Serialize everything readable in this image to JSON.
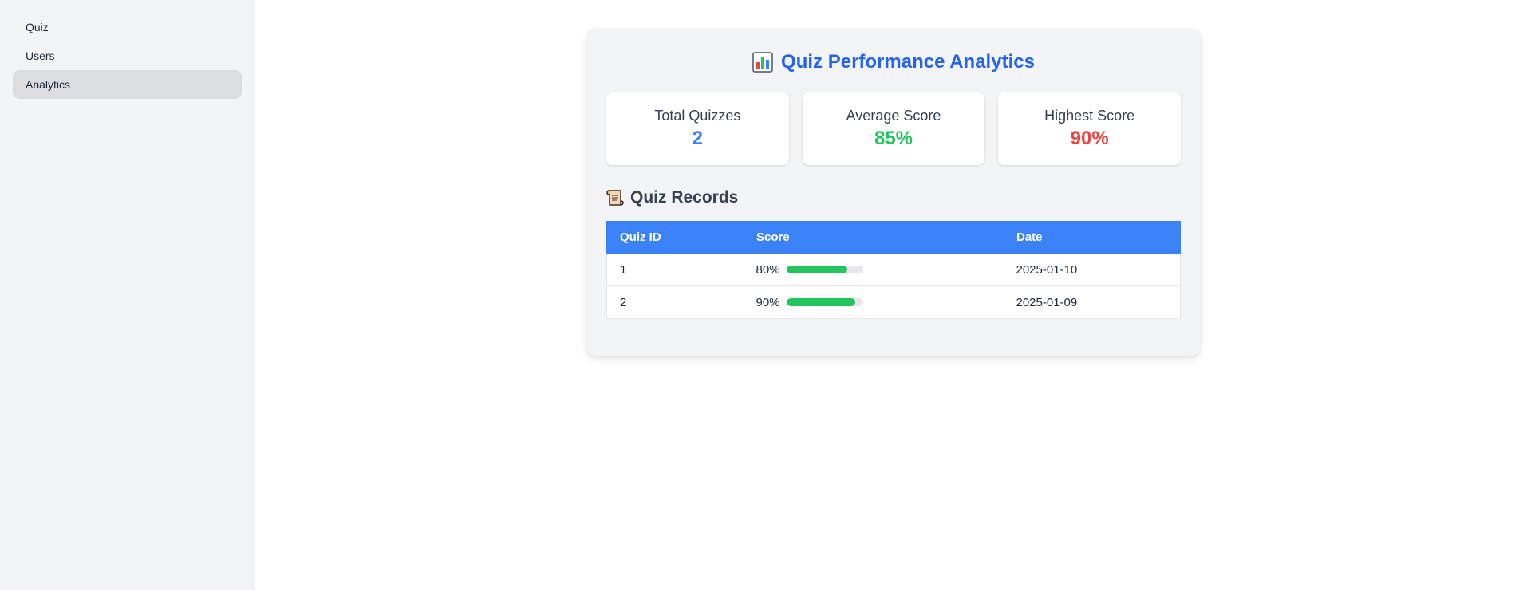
{
  "sidebar": {
    "items": [
      {
        "label": "Quiz",
        "active": false
      },
      {
        "label": "Users",
        "active": false
      },
      {
        "label": "Analytics",
        "active": true
      }
    ]
  },
  "header": {
    "icon": "bar-chart-icon",
    "title": "Quiz Performance Analytics"
  },
  "stats": [
    {
      "label": "Total Quizzes",
      "value": "2",
      "color": "#3b82f6"
    },
    {
      "label": "Average Score",
      "value": "85%",
      "color": "#22c55e"
    },
    {
      "label": "Highest Score",
      "value": "90%",
      "color": "#ef4444"
    }
  ],
  "records": {
    "icon": "scroll-icon",
    "title": "Quiz Records",
    "columns": [
      "Quiz ID",
      "Score",
      "Date"
    ],
    "rows": [
      {
        "id": "1",
        "score_label": "80%",
        "score": 0.8,
        "date": "2025-01-10"
      },
      {
        "id": "2",
        "score_label": "90%",
        "score": 0.9,
        "date": "2025-01-09"
      }
    ]
  },
  "colors": {
    "accent": "#2563eb",
    "table_header": "#3b82f6",
    "progress": "#22c55e"
  }
}
